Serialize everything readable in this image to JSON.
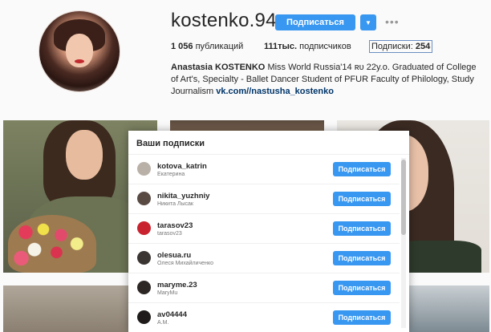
{
  "profile": {
    "username": "kostenko.94",
    "follow_label": "Подписаться",
    "more_label": "•••",
    "posts_count": "1 056",
    "posts_label": "публикаций",
    "followers_count": "111тыс.",
    "followers_label": "подписчиков",
    "following_label": "Подписки:",
    "following_count": "254",
    "bio_name": "Anastasia KOSTENKO",
    "bio_text": "Miss World Russia'14 ʀᴜ 22y.o. Graduated of College of Art's, Specialty - Ballet Dancer Student of PFUR Faculty of Philology, Study Journalism",
    "bio_link": "vk.com//nastusha_kostenko"
  },
  "modal": {
    "title": "Ваши подписки",
    "button_label": "Подписаться",
    "users": [
      {
        "username": "kotova_katrin",
        "name": "Екатерина",
        "avatar_color": "#b9b1a8"
      },
      {
        "username": "nikita_yuzhniy",
        "name": "Никита Лысак",
        "avatar_color": "#5a4a44"
      },
      {
        "username": "tarasov23",
        "name": "tarasov23",
        "avatar_color": "#c8232e"
      },
      {
        "username": "olesua.ru",
        "name": "Олеся Михайличенко",
        "avatar_color": "#3a3432"
      },
      {
        "username": "maryme.23",
        "name": "MaryMu",
        "avatar_color": "#2c2624"
      },
      {
        "username": "av04444",
        "name": "A.M.",
        "avatar_color": "#1f1b1a"
      }
    ]
  },
  "colors": {
    "accent": "#3897f0",
    "link": "#003569"
  }
}
